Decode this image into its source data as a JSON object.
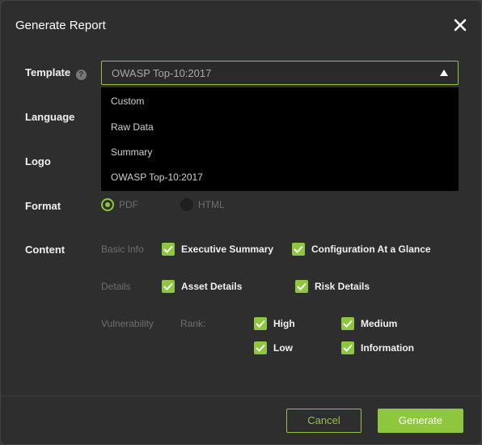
{
  "dialog": {
    "title": "Generate Report"
  },
  "template": {
    "label": "Template",
    "help": "?",
    "selected": "OWASP Top-10:2017",
    "options": [
      "Custom",
      "Raw Data",
      "Summary",
      "OWASP Top-10:2017"
    ]
  },
  "language": {
    "label": "Language"
  },
  "logo": {
    "label": "Logo"
  },
  "format": {
    "label": "Format",
    "options": [
      "PDF",
      "HTML"
    ],
    "selected": "PDF"
  },
  "content": {
    "label": "Content",
    "basic_info": {
      "label": "Basic Info",
      "items": [
        "Executive Summary",
        "Configuration At a Glance"
      ]
    },
    "details": {
      "label": "Details",
      "items": [
        "Asset Details",
        "Risk Details"
      ]
    },
    "vulnerability": {
      "label": "Vulnerability",
      "rank_label": "Rank:",
      "ranks": [
        "High",
        "Medium",
        "Low",
        "Information"
      ]
    }
  },
  "footer": {
    "cancel_label": "Cancel",
    "generate_label": "Generate"
  },
  "colors": {
    "accent": "#8dc63f",
    "background": "#2e2e2e",
    "dropdown": "#000000"
  }
}
